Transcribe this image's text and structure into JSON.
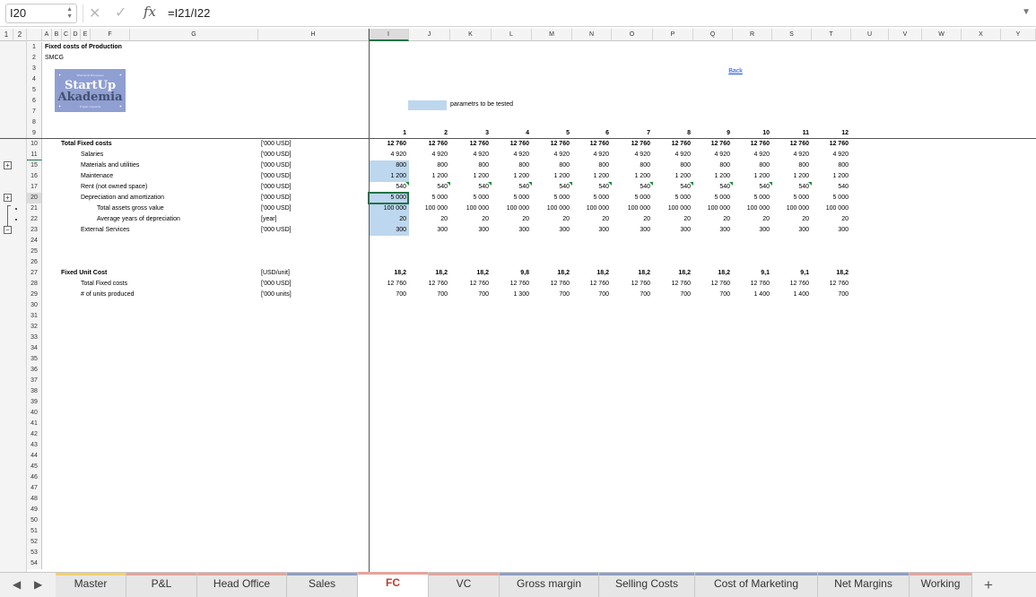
{
  "formula_bar": {
    "name_box": "I20",
    "formula": "=I21/I22",
    "cancel_glyph": "✕",
    "enter_glyph": "✓",
    "fx_label": "fx",
    "expand_glyph": "▼"
  },
  "outline_levels": [
    "1",
    "2"
  ],
  "columns": [
    {
      "id": "A",
      "label": "A"
    },
    {
      "id": "B",
      "label": "B"
    },
    {
      "id": "C",
      "label": "C"
    },
    {
      "id": "D",
      "label": "D"
    },
    {
      "id": "E",
      "label": "E"
    },
    {
      "id": "F",
      "label": "F"
    },
    {
      "id": "G",
      "label": "G"
    },
    {
      "id": "H",
      "label": "H"
    },
    {
      "id": "I",
      "label": "I"
    },
    {
      "id": "J",
      "label": "J"
    },
    {
      "id": "K",
      "label": "K"
    },
    {
      "id": "L",
      "label": "L"
    },
    {
      "id": "M",
      "label": "M"
    },
    {
      "id": "N",
      "label": "N"
    },
    {
      "id": "O",
      "label": "O"
    },
    {
      "id": "P",
      "label": "P"
    },
    {
      "id": "Q",
      "label": "Q"
    },
    {
      "id": "R",
      "label": "R"
    },
    {
      "id": "S",
      "label": "S"
    },
    {
      "id": "T",
      "label": "T"
    },
    {
      "id": "U",
      "label": "U"
    },
    {
      "id": "V",
      "label": "V"
    },
    {
      "id": "W",
      "label": "W"
    },
    {
      "id": "X",
      "label": "X"
    },
    {
      "id": "Y",
      "label": "Y"
    }
  ],
  "row_numbers": [
    "1",
    "2",
    "3",
    "4",
    "5",
    "6",
    "7",
    "8",
    "9",
    "10",
    "11",
    "15",
    "16",
    "17",
    "20",
    "21",
    "22",
    "23",
    "24",
    "25",
    "26",
    "27",
    "28",
    "29",
    "30",
    "31",
    "32",
    "33",
    "34",
    "35",
    "36",
    "37",
    "38",
    "39",
    "40",
    "41",
    "42",
    "43",
    "44",
    "45",
    "46",
    "47",
    "48",
    "49",
    "50",
    "51",
    "52",
    "53",
    "54"
  ],
  "sheet": {
    "title": "Fixed costs of Production",
    "subtitle": "SMCG",
    "logo": {
      "top_text": "Wiedzienie Biznesowe",
      "line1": "StartUp",
      "line2": "Akademia",
      "bottom_text": "Projekt i wsparcie"
    },
    "legend_label": "parametrs to be tested",
    "back_link": "Back",
    "periods": [
      "1",
      "2",
      "3",
      "4",
      "5",
      "6",
      "7",
      "8",
      "9",
      "10",
      "11",
      "12"
    ],
    "rows": [
      {
        "label": "Total Fixed costs",
        "unit": "['000 USD]",
        "values": [
          "12 760",
          "12 760",
          "12 760",
          "12 760",
          "12 760",
          "12 760",
          "12 760",
          "12 760",
          "12 760",
          "12 760",
          "12 760",
          "12 760"
        ]
      },
      {
        "label": "Salaries",
        "unit": "['000 USD]",
        "values": [
          "4 920",
          "4 920",
          "4 920",
          "4 920",
          "4 920",
          "4 920",
          "4 920",
          "4 920",
          "4 920",
          "4 920",
          "4 920",
          "4 920"
        ]
      },
      {
        "label": "Materials and utilities",
        "unit": "['000 USD]",
        "values": [
          "800",
          "800",
          "800",
          "800",
          "800",
          "800",
          "800",
          "800",
          "800",
          "800",
          "800",
          "800"
        ]
      },
      {
        "label": "Maintenace",
        "unit": "['000 USD]",
        "values": [
          "1 200",
          "1 200",
          "1 200",
          "1 200",
          "1 200",
          "1 200",
          "1 200",
          "1 200",
          "1 200",
          "1 200",
          "1 200",
          "1 200"
        ]
      },
      {
        "label": "Rent (not owned space)",
        "unit": "['000 USD]",
        "values": [
          "540",
          "540",
          "540",
          "540",
          "540",
          "540",
          "540",
          "540",
          "540",
          "540",
          "540",
          "540"
        ]
      },
      {
        "label": "Depreciation and amortization",
        "unit": "['000 USD]",
        "values": [
          "5 000",
          "5 000",
          "5 000",
          "5 000",
          "5 000",
          "5 000",
          "5 000",
          "5 000",
          "5 000",
          "5 000",
          "5 000",
          "5 000"
        ]
      },
      {
        "label": "Total assets gross value",
        "unit": "['000 USD]",
        "values": [
          "100 000",
          "100 000",
          "100 000",
          "100 000",
          "100 000",
          "100 000",
          "100 000",
          "100 000",
          "100 000",
          "100 000",
          "100 000",
          "100 000"
        ]
      },
      {
        "label": "Average years of depreciation",
        "unit": "[year]",
        "values": [
          "20",
          "20",
          "20",
          "20",
          "20",
          "20",
          "20",
          "20",
          "20",
          "20",
          "20",
          "20"
        ]
      },
      {
        "label": "External Services",
        "unit": "['000 USD]",
        "values": [
          "300",
          "300",
          "300",
          "300",
          "300",
          "300",
          "300",
          "300",
          "300",
          "300",
          "300",
          "300"
        ]
      },
      {
        "label": "Fixed Unit Cost",
        "unit": "[USD/unit]",
        "values": [
          "18,2",
          "18,2",
          "18,2",
          "9,8",
          "18,2",
          "18,2",
          "18,2",
          "18,2",
          "18,2",
          "9,1",
          "9,1",
          "18,2"
        ]
      },
      {
        "label": "Total Fixed costs",
        "unit": "['000 USD]",
        "values": [
          "12 760",
          "12 760",
          "12 760",
          "12 760",
          "12 760",
          "12 760",
          "12 760",
          "12 760",
          "12 760",
          "12 760",
          "12 760",
          "12 760"
        ]
      },
      {
        "label": "# of units produced",
        "unit": "['000 units]",
        "values": [
          "700",
          "700",
          "700",
          "1 300",
          "700",
          "700",
          "700",
          "700",
          "700",
          "1 400",
          "1 400",
          "700"
        ]
      }
    ]
  },
  "tab_nav": {
    "prev": "◀",
    "next": "▶",
    "add": "+"
  },
  "tabs": [
    {
      "label": "Master",
      "color": "#f2d16b"
    },
    {
      "label": "P&L",
      "color": "#e6a39c"
    },
    {
      "label": "Head Office",
      "color": "#e6a39c"
    },
    {
      "label": "Sales",
      "color": "#8d9ec7"
    },
    {
      "label": "FC",
      "color": "#e6a39c",
      "active": true
    },
    {
      "label": "VC",
      "color": "#e6a39c"
    },
    {
      "label": "Gross margin",
      "color": "#8d9ec7"
    },
    {
      "label": "Selling Costs",
      "color": "#8d9ec7"
    },
    {
      "label": "Cost of Marketing",
      "color": "#8d9ec7"
    },
    {
      "label": "Net Margins",
      "color": "#8d9ec7"
    },
    {
      "label": "Working",
      "color": "#e6a39c"
    }
  ]
}
